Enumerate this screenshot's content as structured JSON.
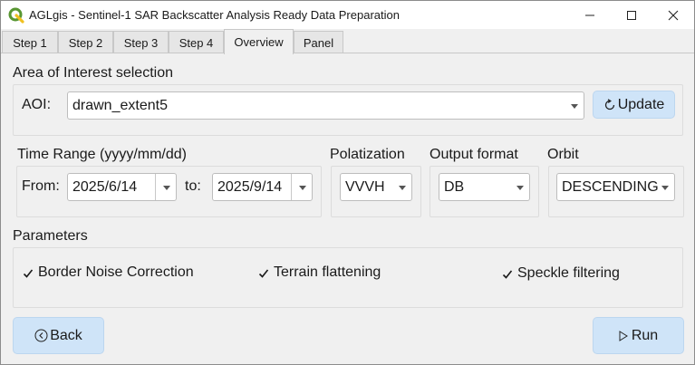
{
  "window": {
    "title": "AGLgis - Sentinel-1 SAR Backscatter Analysis Ready Data Preparation",
    "app_icon": "qgis-logo-icon",
    "controls": [
      "minimize-icon",
      "maximize-icon",
      "close-icon"
    ]
  },
  "tabs": [
    {
      "label": "Step 1",
      "active": false
    },
    {
      "label": "Step 2",
      "active": false
    },
    {
      "label": "Step 3",
      "active": false
    },
    {
      "label": "Step 4",
      "active": false
    },
    {
      "label": "Overview",
      "active": true
    },
    {
      "label": "Panel",
      "active": false
    }
  ],
  "aoi": {
    "section_title": "Area of Interest selection",
    "label": "AOI:",
    "value": "drawn_extent5",
    "update_label": "Update"
  },
  "time_range": {
    "section_title": "Time Range (yyyy/mm/dd)",
    "from_label": "From:",
    "from_value": "2025/6/14",
    "to_label": "to:",
    "to_value": "2025/9/14"
  },
  "polarization": {
    "section_title": "Polatization",
    "value": "VVVH"
  },
  "output_format": {
    "section_title": "Output format",
    "value": "DB"
  },
  "orbit": {
    "section_title": "Orbit",
    "value": "DESCENDING"
  },
  "parameters": {
    "section_title": "Parameters",
    "options": [
      {
        "label": "Border Noise Correction",
        "checked": true
      },
      {
        "label": "Terrain flattening",
        "checked": true
      },
      {
        "label": "Speckle filtering",
        "checked": true
      }
    ]
  },
  "footer": {
    "back_label": "Back",
    "run_label": "Run"
  },
  "colors": {
    "button_bg": "#cfe4f8",
    "window_bg": "#f0f0f0",
    "qgis_green": "#589632",
    "qgis_yellow": "#f0c020"
  }
}
